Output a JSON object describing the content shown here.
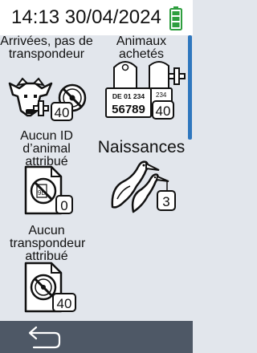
{
  "status": {
    "time": "14:13 30/04/2024",
    "battery_icon": "battery-full-icon",
    "battery_color": "#2e9e3e"
  },
  "tiles": [
    {
      "label": "Arrivées, pas de transpondeur",
      "count": "40",
      "icon": "cattle-no-transponder-icon"
    },
    {
      "label": "Animaux achetés",
      "count": "40",
      "icon": "ear-tag-plus-icon",
      "tag_line": "DE 01 234",
      "tag_number": "56789",
      "small_tag": "234"
    },
    {
      "label": "Aucun ID d’animal attribué",
      "count": "0",
      "icon": "document-no-id-icon"
    },
    {
      "label": "Naissances",
      "count": "3",
      "icon": "stork-icon"
    },
    {
      "label": "Aucun transpondeur attribué",
      "count": "40",
      "icon": "document-no-transponder-icon"
    }
  ],
  "footer": {
    "back_icon": "back-arrow-icon"
  },
  "colors": {
    "accent": "#2f77be",
    "footer": "#4e5866",
    "background": "#e2e6ec"
  }
}
